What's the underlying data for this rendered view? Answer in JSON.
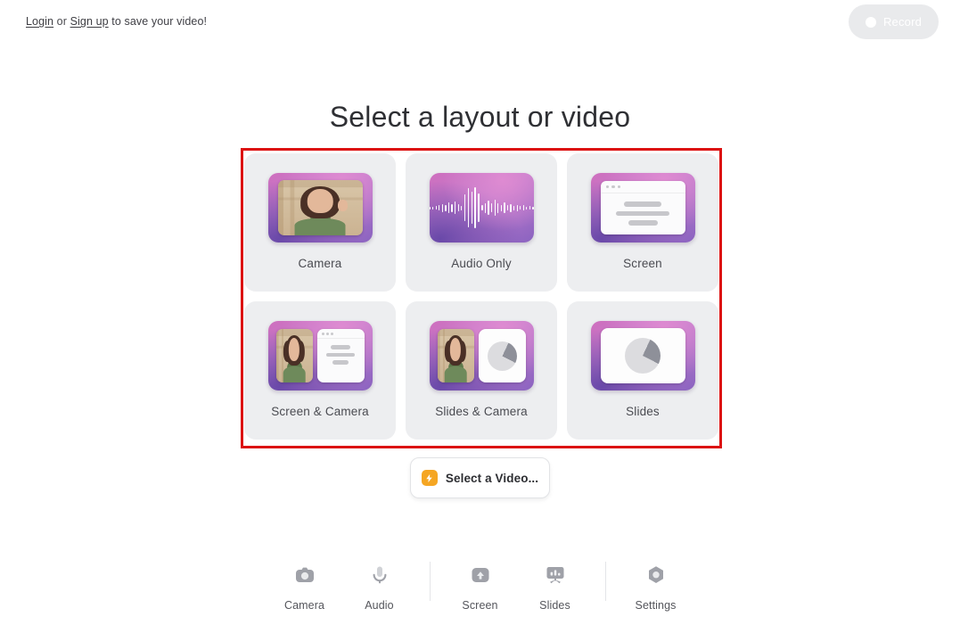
{
  "topbar": {
    "login_label": "Login",
    "or_label": "or",
    "signup_label": "Sign up",
    "note_tail": "to save your video!",
    "record_label": "Record",
    "record_icon": "record-dot-icon",
    "record_bg": "#e9eaec"
  },
  "main": {
    "title": "Select a layout or video",
    "highlight_color": "#dc1212",
    "cards": [
      {
        "label": "Camera",
        "thumb": "camera-thumb"
      },
      {
        "label": "Audio Only",
        "thumb": "audio-waveform-thumb"
      },
      {
        "label": "Screen",
        "thumb": "screen-window-thumb"
      },
      {
        "label": "Screen & Camera",
        "thumb": "screen-camera-thumb"
      },
      {
        "label": "Slides & Camera",
        "thumb": "slides-camera-thumb"
      },
      {
        "label": "Slides",
        "thumb": "slides-thumb"
      }
    ],
    "select_video": {
      "label": "Select a Video...",
      "icon": "spark-icon",
      "icon_color": "#f5a623"
    }
  },
  "toolbar": {
    "items": [
      {
        "label": "Camera",
        "icon": "camera-icon"
      },
      {
        "label": "Audio",
        "icon": "microphone-icon"
      },
      {
        "label": "Screen",
        "icon": "screen-share-icon"
      },
      {
        "label": "Slides",
        "icon": "slides-icon"
      },
      {
        "label": "Settings",
        "icon": "gear-icon"
      }
    ]
  }
}
